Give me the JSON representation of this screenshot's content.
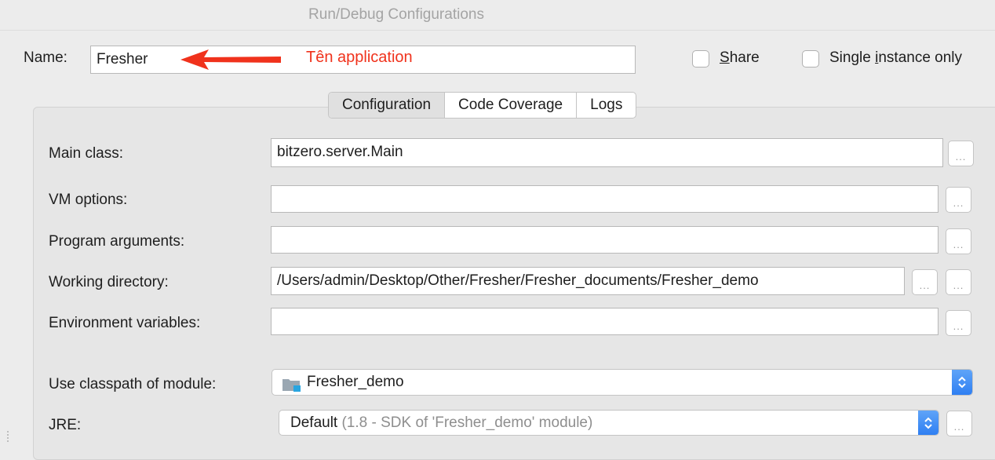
{
  "window": {
    "title": "Run/Debug Configurations"
  },
  "name_row": {
    "label": "Name:",
    "value": "Fresher",
    "annotation": "Tên application",
    "annotation_color": "#f0321c",
    "share_label": "Share",
    "single_instance_label": "Single instance only"
  },
  "tabs": [
    {
      "label": "Configuration",
      "active": true
    },
    {
      "label": "Code Coverage",
      "active": false
    },
    {
      "label": "Logs",
      "active": false
    }
  ],
  "form": {
    "main_class": {
      "label": "Main class:",
      "value": "bitzero.server.Main"
    },
    "vm_options": {
      "label": "VM options:",
      "value": ""
    },
    "program_arguments": {
      "label": "Program arguments:",
      "value": ""
    },
    "working_directory": {
      "label": "Working directory:",
      "value": "/Users/admin/Desktop/Other/Fresher/Fresher_documents/Fresher_demo"
    },
    "environment_variables": {
      "label": "Environment variables:",
      "value": ""
    },
    "classpath_module": {
      "label": "Use classpath of module:",
      "value": "Fresher_demo",
      "icon": "module-folder-icon"
    },
    "jre": {
      "label": "JRE:",
      "value": "Default",
      "detail": "(1.8 - SDK of 'Fresher_demo' module)"
    }
  },
  "ellipsis_text": "...",
  "colors": {
    "accent": "#3a87f5",
    "window_bg": "#ececec",
    "panel_bg": "#e6e6e6"
  }
}
